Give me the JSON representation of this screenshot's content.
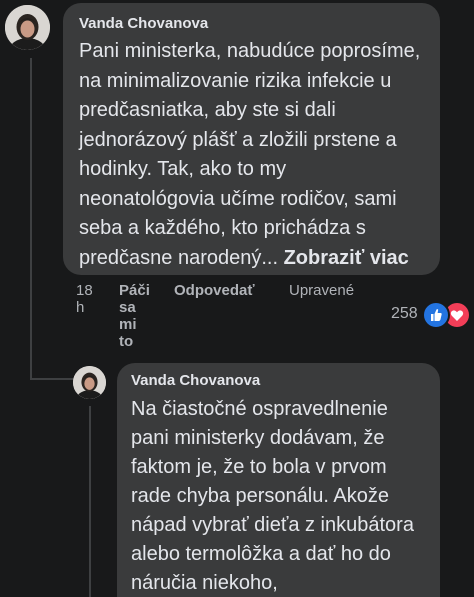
{
  "comment": {
    "author": "Vanda Chovanova",
    "text": "Pani ministerka, nabudúce poprosíme, na minimalizovanie rizika infekcie u predčasniatka, aby ste si dali jednorázový plášť a zložili prstene a hodinky. Tak, ako to my neonatológovia učíme rodičov, sami seba a každého, kto prichádza s predčasne narodený...",
    "see_more": "Zobraziť viac",
    "time": "18 h",
    "like_label": "Páči sa mi to",
    "reply_label": "Odpovedať",
    "edited_label": "Upravené",
    "reaction_count": "258",
    "reactions": [
      "like-icon",
      "love-icon"
    ],
    "colors": {
      "like": "#2374e1",
      "love": "#f33e58",
      "bubble": "#3a3b3c",
      "background": "#18191a"
    }
  },
  "reply": {
    "author": "Vanda Chovanova",
    "text": "Na čiastočné ospravedlnenie pani ministerky dodávam, že faktom je, že to bola v prvom rade chyba personálu. Akože nápad vybrať dieťa z inkubátora alebo termolôžka a dať ho do náručia niekoho,"
  }
}
